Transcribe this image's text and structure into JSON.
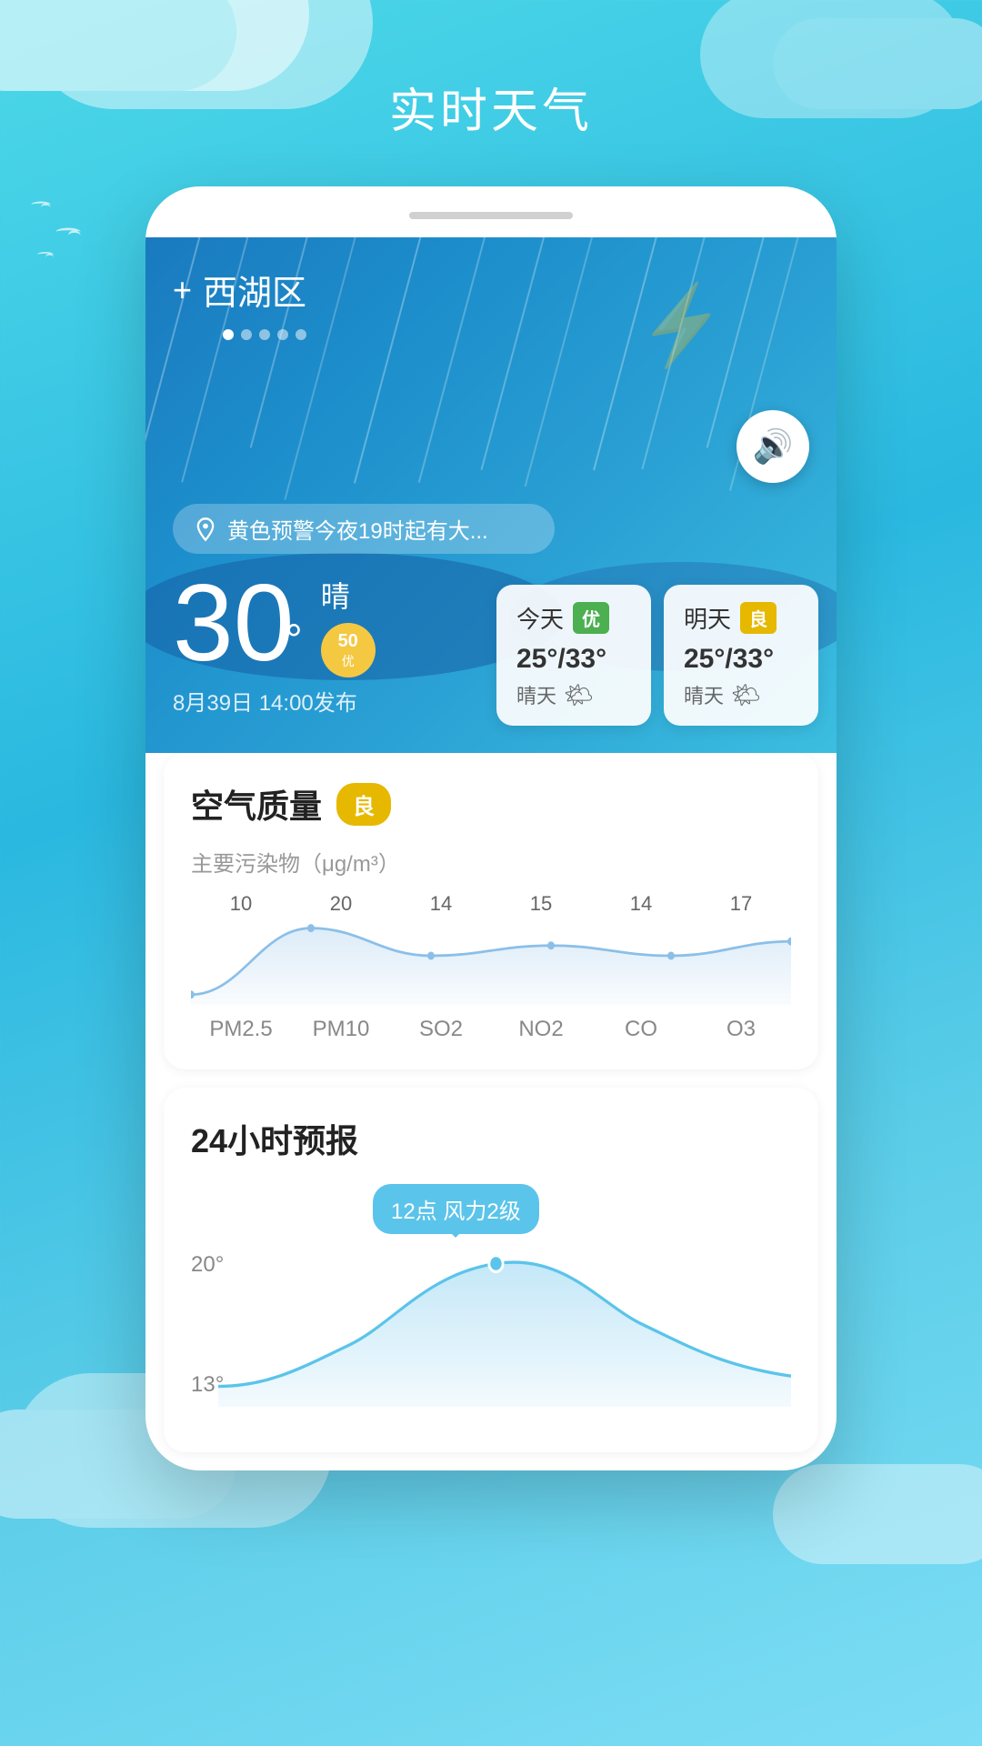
{
  "page": {
    "title": "实时天气",
    "background_gradient_start": "#4dd8e8",
    "background_gradient_end": "#7dddf5"
  },
  "location": {
    "name": "西湖区",
    "add_label": "+",
    "dots": [
      true,
      false,
      false,
      false,
      false
    ]
  },
  "alert": {
    "text": "黄色预警今夜19时起有大..."
  },
  "current_weather": {
    "temperature": "30",
    "degree_symbol": "°",
    "weather_type": "晴",
    "aqi_value": "50",
    "aqi_text": "优",
    "publish_time": "8月39日 14:00发布"
  },
  "forecast_today": {
    "day_label": "今天",
    "quality_badge": "优",
    "temp_range": "25°/33°",
    "weather": "晴天",
    "icon": "🌤"
  },
  "forecast_tomorrow": {
    "day_label": "明天",
    "quality_badge": "良",
    "temp_range": "25°/33°",
    "weather": "晴天",
    "icon": "🌤"
  },
  "air_quality": {
    "title": "空气质量",
    "quality_label": "良",
    "pollutants_label": "主要污染物（μg/m³）",
    "metrics": [
      {
        "name": "PM2.5",
        "value": "10"
      },
      {
        "name": "PM10",
        "value": "20"
      },
      {
        "name": "SO2",
        "value": "14"
      },
      {
        "name": "NO2",
        "value": "15"
      },
      {
        "name": "CO",
        "value": "14"
      },
      {
        "name": "O3",
        "value": "17"
      }
    ],
    "chart_line_color": "#8bbfe8"
  },
  "forecast_24h": {
    "title": "24小时预报",
    "tooltip": "12点 风力2级",
    "y_label_high": "20°",
    "y_label_low": "13°"
  }
}
